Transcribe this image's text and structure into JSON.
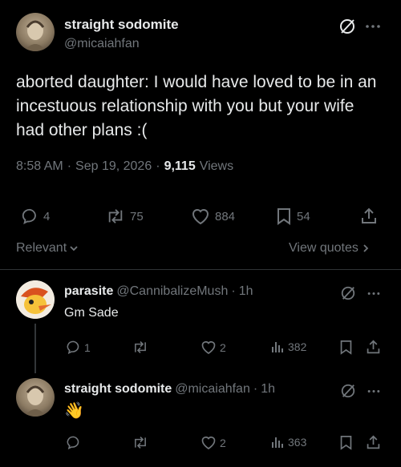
{
  "main_post": {
    "display_name": "straight sodomite",
    "handle": "@micaiahfan",
    "text": "aborted daughter: I would have loved to be in an incestuous relationship with you but your wife had other plans :(",
    "time": "8:58 AM",
    "sep1": "·",
    "date": "Sep 19, 2026",
    "sep2": "·",
    "views_count": "9,115",
    "views_label": "Views",
    "replies": "4",
    "reposts": "75",
    "likes": "884",
    "bookmarks": "54"
  },
  "filter": {
    "relevant_label": "Relevant",
    "view_quotes_label": "View quotes"
  },
  "replies": [
    {
      "display_name": "parasite",
      "handle": "@CannibalizeMush",
      "sep": "·",
      "time": "1h",
      "text": "Gm Sade",
      "replies": "1",
      "reposts": "",
      "likes": "2",
      "views": "382"
    },
    {
      "display_name": "straight sodomite",
      "handle": "@micaiahfan",
      "sep": "·",
      "time": "1h",
      "text": "👋",
      "replies": "",
      "reposts": "",
      "likes": "2",
      "views": "363"
    }
  ],
  "colors": {
    "background": "#000000",
    "text": "#e7e9ea",
    "muted": "#71767b",
    "divider": "#2f3336"
  },
  "icons": [
    "grok-icon",
    "more-icon",
    "reply-icon",
    "repost-icon",
    "like-icon",
    "bookmark-icon",
    "share-icon",
    "views-icon",
    "chevron-down-icon",
    "chevron-right-icon"
  ]
}
